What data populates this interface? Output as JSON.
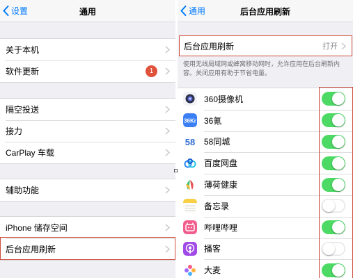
{
  "left": {
    "nav_back_label": "设置",
    "nav_title": "通用",
    "about": "关于本机",
    "software_update": "软件更新",
    "update_badge": "1",
    "airdrop": "隔空投送",
    "handoff": "接力",
    "carplay": "CarPlay 车载",
    "accessibility": "辅助功能",
    "storage": "iPhone 储存空间",
    "background_refresh": "后台应用刷新"
  },
  "right": {
    "nav_back_label": "通用",
    "nav_title": "后台应用刷新",
    "setting_label": "后台应用刷新",
    "setting_value": "打开",
    "description": "使用无线局域网或蜂窝移动网时，允许应用在后台刷新内容。关闭应用有助于节省电量。",
    "apps": [
      {
        "name": "360摄像机",
        "icon": "360-camera-icon",
        "enabled": true
      },
      {
        "name": "36氪",
        "icon": "36kr-icon",
        "enabled": true
      },
      {
        "name": "58同城",
        "icon": "58-tongcheng-icon",
        "enabled": true
      },
      {
        "name": "百度网盘",
        "icon": "baidu-netdisk-icon",
        "enabled": true
      },
      {
        "name": "薄荷健康",
        "icon": "mint-health-icon",
        "enabled": true
      },
      {
        "name": "备忘录",
        "icon": "notes-icon",
        "enabled": false
      },
      {
        "name": "哔哩哔哩",
        "icon": "bilibili-icon",
        "enabled": true
      },
      {
        "name": "播客",
        "icon": "podcasts-icon",
        "enabled": false
      },
      {
        "name": "大麦",
        "icon": "damai-icon",
        "enabled": true
      }
    ]
  },
  "colors": {
    "ios_blue": "#007aff",
    "switch_on": "#4cd964",
    "highlight_red": "#cc4a3a",
    "badge_red": "#e0513b"
  }
}
